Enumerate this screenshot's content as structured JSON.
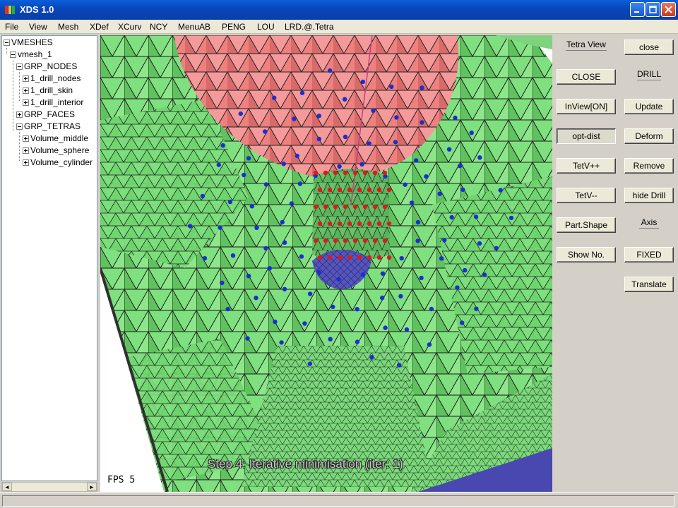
{
  "window": {
    "title": "XDS 1.0"
  },
  "menu": [
    "File",
    "View",
    "Mesh",
    "XDef",
    "XCurv",
    "NCY",
    "MenuAB",
    "PENG",
    "LOU",
    "LRD.@.Tetra"
  ],
  "tree": {
    "items": [
      {
        "label": "VMESHES",
        "box": "minus"
      },
      {
        "label": "vmesh_1",
        "box": "minus"
      },
      {
        "label": "GRP_NODES",
        "box": "minus"
      },
      {
        "label": "1_drill_nodes",
        "box": "plus"
      },
      {
        "label": "1_drill_skin",
        "box": "plus"
      },
      {
        "label": "1_drill_interior",
        "box": "plus"
      },
      {
        "label": "GRP_FACES",
        "box": "plus"
      },
      {
        "label": "GRP_TETRAS",
        "box": "minus"
      },
      {
        "label": "Volume_middle",
        "box": "plus"
      },
      {
        "label": "Volume_sphere",
        "box": "plus"
      },
      {
        "label": "Volume_cylinder",
        "box": "plus"
      }
    ]
  },
  "viewport": {
    "fps_label": "FPS",
    "fps_value": "5",
    "caption": "Step 4: Iterative minimisation (iter: 1)",
    "colors": {
      "mesh": "#6fd66f",
      "sphere": "#ee7f7f",
      "drill": "#5ab85a",
      "drill_bottom": "#5555bb",
      "node_blue": "#1a2fd0",
      "node_red": "#dd1a1a",
      "edge": "#1a1a1a"
    }
  },
  "panel": {
    "tetra_view_label": "Tetra View",
    "drill_label": "DRILL",
    "axis_label": "Axis",
    "buttons": {
      "close_small": "close",
      "close_caps": "CLOSE",
      "inview": "InView[ON]",
      "update": "Update",
      "opt_dist": "opt-dist",
      "deform": "Deform",
      "tetv_plus": "TetV++",
      "remove": "Remove",
      "tetv_minus": "TetV--",
      "hide_drill": "hide Drill",
      "part_shape": "Part.Shape",
      "show_no": "Show No.",
      "fixed": "FIXED",
      "translate": "Translate"
    }
  },
  "status": {
    "text": ""
  }
}
